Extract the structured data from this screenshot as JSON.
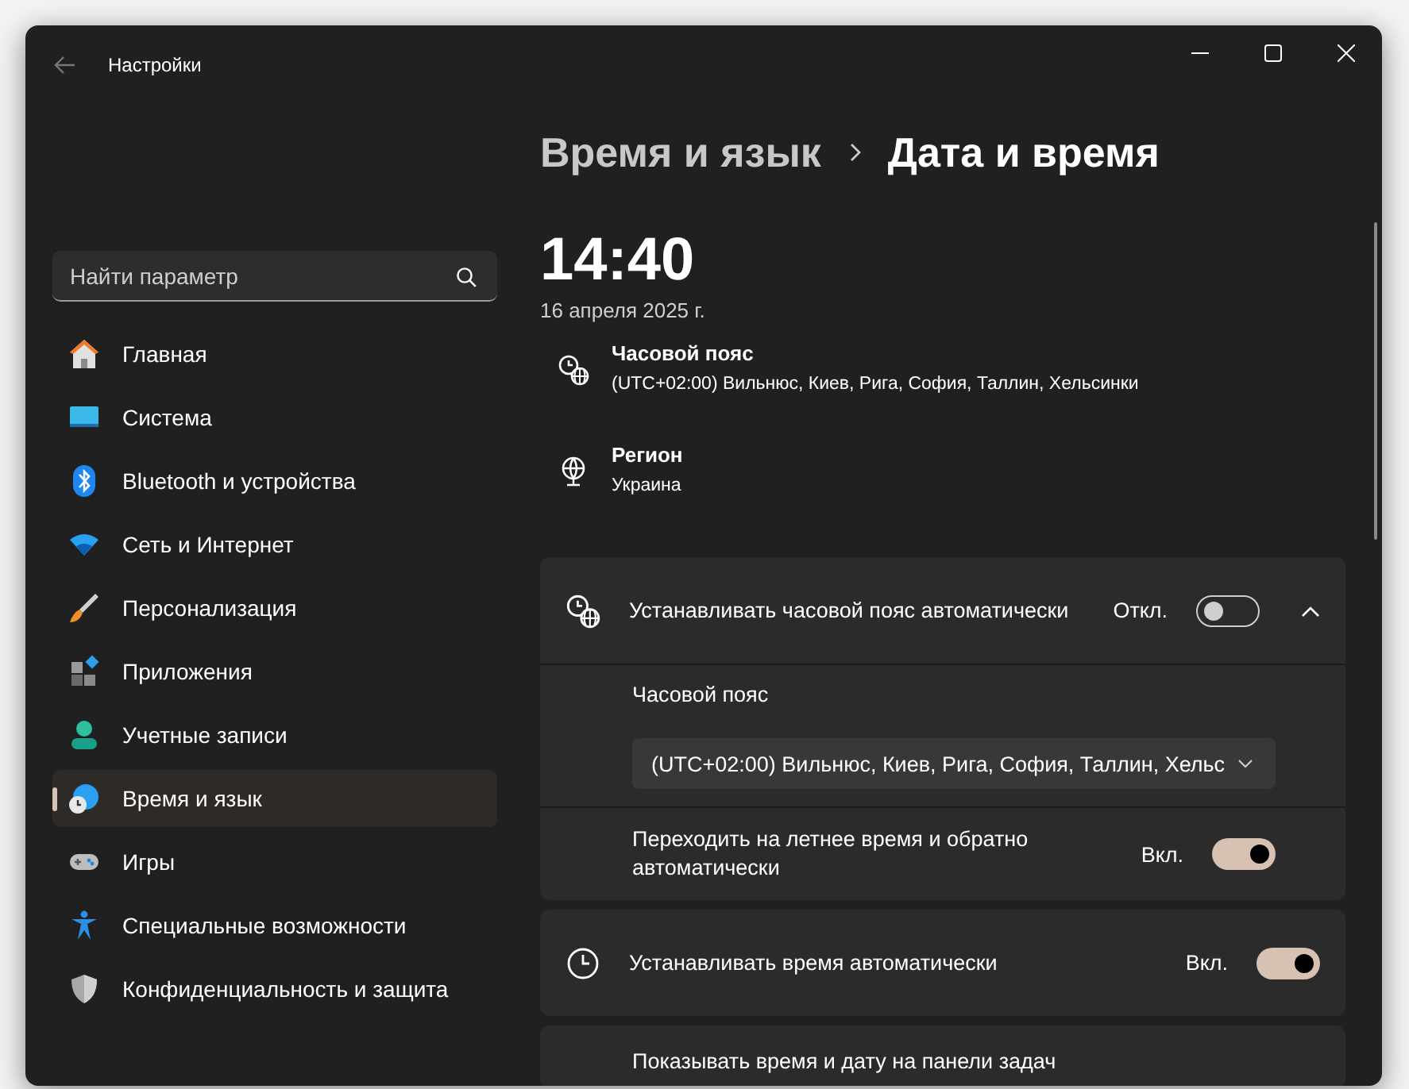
{
  "window": {
    "title": "Настройки"
  },
  "search": {
    "placeholder": "Найти параметр"
  },
  "sidebar": {
    "items": [
      {
        "label": "Главная",
        "selected": false
      },
      {
        "label": "Система",
        "selected": false
      },
      {
        "label": "Bluetooth и устройства",
        "selected": false
      },
      {
        "label": "Сеть и Интернет",
        "selected": false
      },
      {
        "label": "Персонализация",
        "selected": false
      },
      {
        "label": "Приложения",
        "selected": false
      },
      {
        "label": "Учетные записи",
        "selected": false
      },
      {
        "label": "Время и язык",
        "selected": true
      },
      {
        "label": "Игры",
        "selected": false
      },
      {
        "label": "Специальные возможности",
        "selected": false
      },
      {
        "label": "Конфиденциальность и защита",
        "selected": false
      }
    ]
  },
  "breadcrumb": {
    "parent": "Время и язык",
    "current": "Дата и время"
  },
  "clock": {
    "time": "14:40",
    "date": "16 апреля 2025 г."
  },
  "info": [
    {
      "kind": "timezone",
      "title": "Часовой пояс",
      "value": "(UTC+02:00) Вильнюс, Киев, Рига, София, Таллин, Хельсинки"
    },
    {
      "kind": "region",
      "title": "Регион",
      "value": "Украина"
    }
  ],
  "auto_timezone": {
    "label": "Устанавливать часовой пояс автоматически",
    "state_label": "Откл.",
    "on": false,
    "expanded": true,
    "timezone_label": "Часовой пояс",
    "timezone_value": "(UTC+02:00) Вильнюс, Киев, Рига, София, Таллин, Хельс",
    "dst": {
      "label": "Переходить на летнее время и обратно автоматически",
      "state_label": "Вкл.",
      "on": true
    }
  },
  "auto_time": {
    "label": "Устанавливать время автоматически",
    "state_label": "Вкл.",
    "on": true
  },
  "taskbar_row": {
    "label": "Показывать время и дату на панели задач"
  }
}
